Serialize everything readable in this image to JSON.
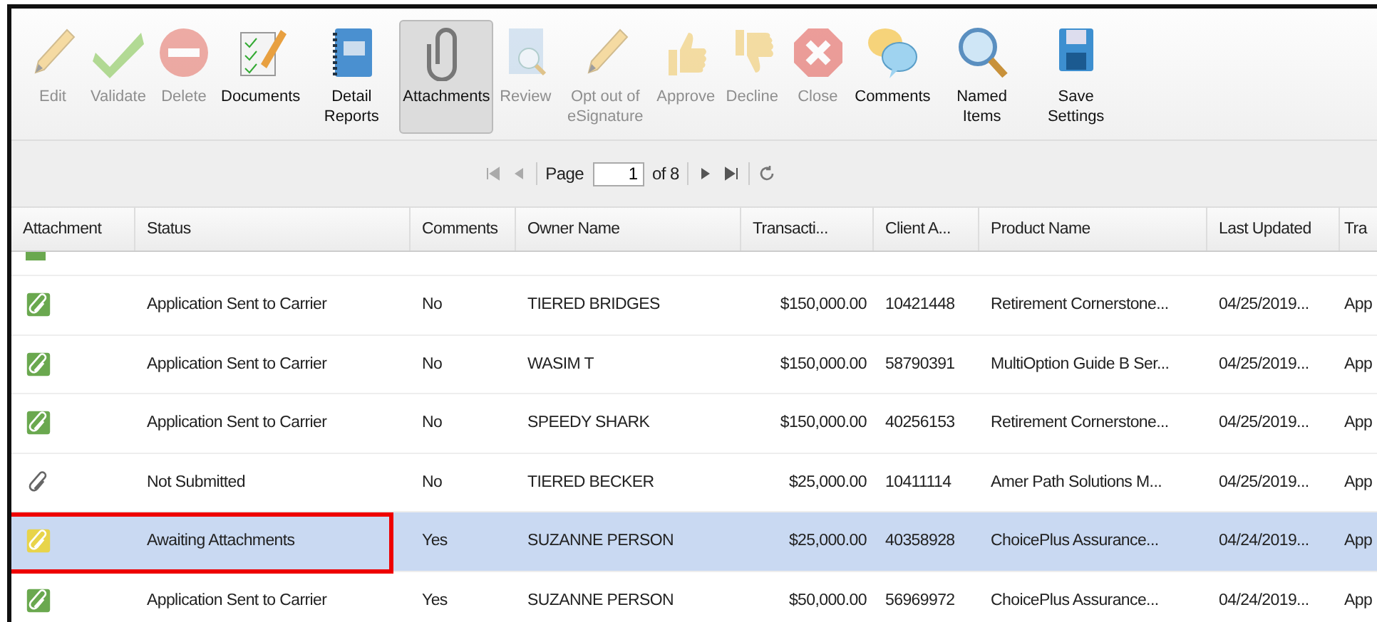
{
  "toolbar": [
    {
      "kind": "pencil",
      "label": "Edit",
      "disabled": true,
      "selected": false
    },
    {
      "kind": "check",
      "label": "Validate",
      "disabled": true,
      "selected": false
    },
    {
      "kind": "minus",
      "label": "Delete",
      "disabled": true,
      "selected": false
    },
    {
      "kind": "checklist",
      "label": "Documents",
      "disabled": false,
      "selected": false
    },
    {
      "kind": "notebook",
      "label": "Detail Reports",
      "disabled": false,
      "selected": false
    },
    {
      "kind": "clip",
      "label": "Attachments",
      "disabled": false,
      "selected": true
    },
    {
      "kind": "review",
      "label": "Review",
      "disabled": true,
      "selected": false
    },
    {
      "kind": "pencil",
      "label": "Opt out of eSignature",
      "disabled": true,
      "selected": false
    },
    {
      "kind": "thumbup",
      "label": "Approve",
      "disabled": true,
      "selected": false
    },
    {
      "kind": "thumbdown",
      "label": "Decline",
      "disabled": true,
      "selected": false
    },
    {
      "kind": "close",
      "label": "Close",
      "disabled": true,
      "selected": false
    },
    {
      "kind": "bubbles",
      "label": "Comments",
      "disabled": false,
      "selected": false
    },
    {
      "kind": "magnifier",
      "label": "Named Items",
      "disabled": false,
      "selected": false
    },
    {
      "kind": "floppy",
      "label": "Save Settings",
      "disabled": false,
      "selected": false
    }
  ],
  "pager": {
    "label": "Page",
    "value": "1",
    "of": "of 8"
  },
  "table": {
    "columns": [
      "Attachment",
      "Status",
      "Comments",
      "Owner Name",
      "Transacti...",
      "Client A...",
      "Product Name",
      "Last Updated",
      "Tra"
    ],
    "rows": [
      {
        "kind": "complete",
        "selected": false,
        "highlighted": false,
        "cells": [
          "",
          "Application Sent to Carrier",
          "No",
          "TIERED BRIDGES",
          "$150,000.00",
          "10421448",
          "Retirement Cornerstone...",
          "04/25/2019...",
          "App"
        ]
      },
      {
        "kind": "complete",
        "selected": false,
        "highlighted": false,
        "cells": [
          "",
          "Application Sent to Carrier",
          "No",
          "WASIM T",
          "$150,000.00",
          "58790391",
          "MultiOption Guide B Ser...",
          "04/25/2019...",
          "App"
        ]
      },
      {
        "kind": "complete",
        "selected": false,
        "highlighted": false,
        "cells": [
          "",
          "Application Sent to Carrier",
          "No",
          "SPEEDY SHARK",
          "$150,000.00",
          "40256153",
          "Retirement Cornerstone...",
          "04/25/2019...",
          "App"
        ]
      },
      {
        "kind": "none",
        "selected": false,
        "highlighted": false,
        "cells": [
          "",
          "Not Submitted",
          "No",
          "TIERED BECKER",
          "$25,000.00",
          "10411114",
          "Amer Path Solutions M...",
          "04/25/2019...",
          "App"
        ]
      },
      {
        "kind": "pending",
        "selected": true,
        "highlighted": true,
        "cells": [
          "",
          "Awaiting Attachments",
          "Yes",
          "SUZANNE PERSON",
          "$25,000.00",
          "40358928",
          "ChoicePlus Assurance...",
          "04/24/2019...",
          "App"
        ]
      },
      {
        "kind": "complete",
        "selected": false,
        "highlighted": false,
        "cells": [
          "",
          "Application Sent to Carrier",
          "Yes",
          "SUZANNE PERSON",
          "$50,000.00",
          "56969972",
          "ChoicePlus Assurance...",
          "04/24/2019...",
          "App"
        ]
      }
    ]
  }
}
